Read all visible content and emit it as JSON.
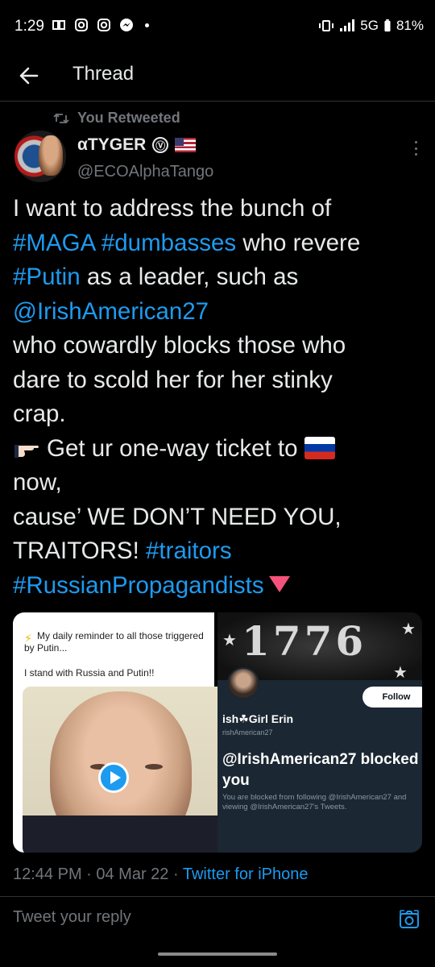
{
  "status_bar": {
    "time": "1:29",
    "network": "5G",
    "battery": "81%",
    "icons": [
      "book-icon",
      "instagram-icon",
      "instagram-icon",
      "messenger-icon"
    ]
  },
  "header": {
    "title": "Thread"
  },
  "retweet": {
    "label": "You Retweeted"
  },
  "author": {
    "name": "αTYGER",
    "verified_glyph": "Ⓥ",
    "handle": "@ECOAlphaTango"
  },
  "tweet": {
    "p1": "I want to address the bunch of",
    "tag_maga": "#MAGA",
    "tag_dumb": "#dumbasses",
    "p2": " who revere",
    "tag_putin": "#Putin",
    "p3": " as a leader, such as",
    "mention": "@IrishAmerican27",
    "p4": "who cowardly blocks those who",
    "p5": "dare to scold her for her stinky",
    "p6": "crap.",
    "p7": "Get ur one-way ticket to",
    "p8": "now,",
    "p9": "cause’ WE DON’T NEED YOU,",
    "p10": "TRAITORS! ",
    "tag_traitors": "#traitors",
    "tag_russian": "#RussianPropagandists"
  },
  "media_left": {
    "line1": "My daily reminder to all those triggered by Putin...",
    "line2": "I stand with Russia and Putin!!"
  },
  "media_right": {
    "banner_text": "1776",
    "follow_label": "Follow",
    "profile_name": "ish☘Girl Erin",
    "profile_handle": "rishAmerican27",
    "blocked_title": "@IrishAmerican27 blocked you",
    "blocked_sub": "You are blocked from following @IrishAmerican27 and viewing @IrishAmerican27's Tweets."
  },
  "meta": {
    "time": "12:44 PM · 04 Mar 22 · ",
    "source": "Twitter for iPhone"
  },
  "reply": {
    "placeholder": "Tweet your reply"
  },
  "colors": {
    "background": "#000000",
    "link": "#1d9bf0",
    "muted": "#71767b",
    "text": "#e7e9ea"
  }
}
